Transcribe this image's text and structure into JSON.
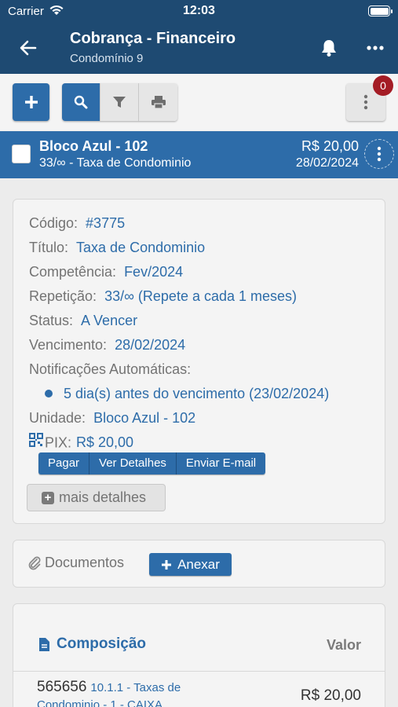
{
  "status_bar": {
    "carrier": "Carrier",
    "time": "12:03"
  },
  "nav": {
    "title": "Cobrança - Financeiro",
    "subtitle": "Condomínio 9"
  },
  "toolbar": {
    "badge_count": "0"
  },
  "item": {
    "title": "Bloco Azul - 102",
    "subtitle": "33/∞ - Taxa de Condominio",
    "value": "R$ 20,00",
    "date": "28/02/2024"
  },
  "details": {
    "codigo_label": "Código:",
    "codigo": "#3775",
    "titulo_label": "Título:",
    "titulo": "Taxa de Condominio",
    "competencia_label": "Competência:",
    "competencia": "Fev/2024",
    "repeticao_label": "Repetição:",
    "repeticao": "33/∞ (Repete a cada 1 meses)",
    "status_label": "Status:",
    "status": "A Vencer",
    "vencimento_label": "Vencimento:",
    "vencimento": "28/02/2024",
    "notificacoes_label": "Notificações Automáticas:",
    "notificacao_item": "5 dia(s) antes do vencimento (23/02/2024)",
    "unidade_label": "Unidade:",
    "unidade": "Bloco Azul - 102",
    "pix_label": "PIX:",
    "pix_value": "R$ 20,00",
    "pix_buttons": [
      "Pagar",
      "Ver Detalhes",
      "Enviar E-mail"
    ],
    "more_details": "mais detalhes"
  },
  "documents": {
    "label": "Documentos",
    "attach_button": "Anexar"
  },
  "composition": {
    "title": "Composição",
    "value_header": "Valor",
    "rows": [
      {
        "code": "565656",
        "account": "10.1.1 - Taxas de Condominio - 1 - CAIXA",
        "value": "R$ 20,00"
      }
    ]
  },
  "colors": {
    "primary": "#2d6ca9",
    "header": "#1e4a72",
    "badge": "#a41c25"
  },
  "icons": [
    "wifi-icon",
    "battery-icon",
    "back-arrow-icon",
    "bell-icon",
    "more-icon",
    "plus-icon",
    "search-icon",
    "filter-icon",
    "print-icon",
    "kebab-icon",
    "checkbox-icon",
    "qr-icon",
    "paperclip-icon",
    "document-icon"
  ]
}
